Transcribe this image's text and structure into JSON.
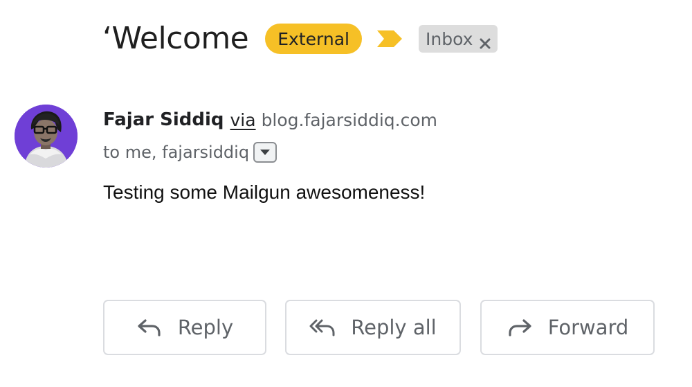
{
  "subject": "‘Welcome",
  "labels": {
    "external": "External",
    "inbox": "Inbox"
  },
  "icons": {
    "importance": "importance-marker-icon",
    "remove_label": "close-icon",
    "details": "caret-down-icon",
    "reply": "reply-icon",
    "reply_all": "reply-all-icon",
    "forward": "forward-icon"
  },
  "sender": {
    "name": "Fajar Siddiq",
    "via": "via",
    "domain": "blog.fajarsiddiq.com"
  },
  "recipients": "to me, fajarsiddiq",
  "body": "Testing some Mailgun awesomeness!",
  "actions": {
    "reply": "Reply",
    "reply_all": "Reply all",
    "forward": "Forward"
  },
  "colors": {
    "external_badge": "#f6c026",
    "importance_marker": "#f6c026",
    "inbox_chip": "#dddddd",
    "avatar_background": "#6f3fd6"
  }
}
